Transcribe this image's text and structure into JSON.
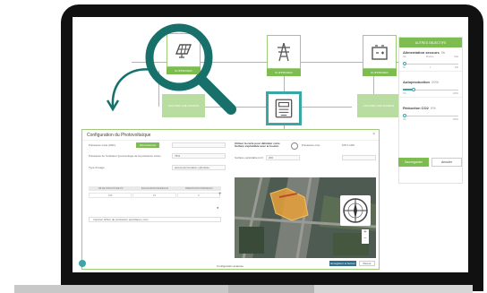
{
  "diagram": {
    "nodes": [
      {
        "id": "solar",
        "label": "SUPPRIMER",
        "icon": "solar-panel-icon"
      },
      {
        "id": "grid",
        "label": "SUPPRIMER",
        "icon": "power-pylon-icon"
      },
      {
        "id": "battery",
        "label": "SUPPRIMER",
        "icon": "battery-icon"
      }
    ],
    "ghosts": [
      {
        "label": "AJOUTER UNE SOURCE"
      },
      {
        "label": "AJOUTER UNE SOURCE"
      }
    ],
    "center_icon": "electric-meter-icon"
  },
  "objectives": {
    "title": "AUTRES OBJECTIFS",
    "sections": [
      {
        "name": "Alimentation secours",
        "value": "0h",
        "ticks": [
          "Nul",
          "Moderé",
          "Total"
        ],
        "ticks2": [
          "0h",
          "1",
          "24h"
        ],
        "level": 0.0
      },
      {
        "name": "Autoproduction",
        "value": "20%",
        "ticks2": [
          "0%",
          "",
          "100%"
        ],
        "level": 0.2
      },
      {
        "name": "Réduction CO2",
        "value": "0%",
        "ticks2": [
          "0%",
          "",
          "100%"
        ],
        "level": 0.0
      }
    ],
    "save_label": "Sauvegarder",
    "cancel_label": "Annuler",
    "accent": "#7dbd4f",
    "teal": "#3aa6a6"
  },
  "modal": {
    "title": "Configuration du Photovoltaïque",
    "close": "×",
    "power_label": "Puissance crête (kWc)",
    "power_button": "Dimensionner",
    "share_label": "Puissance de l'onduleur (pourcentage de la puissance crête)",
    "share_value": "75%",
    "type_label": "Type d'usage",
    "type_value": "autoconsommation optimisée",
    "table_headers": [
      "NB DE STRUCTURE PV",
      "INCLINAISON PANNEAUX",
      "ORIENTATION PANNEAUX"
    ],
    "table_row": [
      "100",
      "15",
      "0"
    ],
    "import_label": "Importer fichier de production spécifique (.csv)",
    "map_hint": "Utiliser la carte pour délimiter votre Surface exploitable avec le bouton",
    "surface_label": "Surface exploitable (m²)",
    "surface_value": "200",
    "panels_label": "Puissance max.",
    "panels_value": "105.1 kWc",
    "footer_link": "Configuration avancée",
    "btn_nav": "Enregistrer et fermer",
    "btn_back": "Retour"
  }
}
